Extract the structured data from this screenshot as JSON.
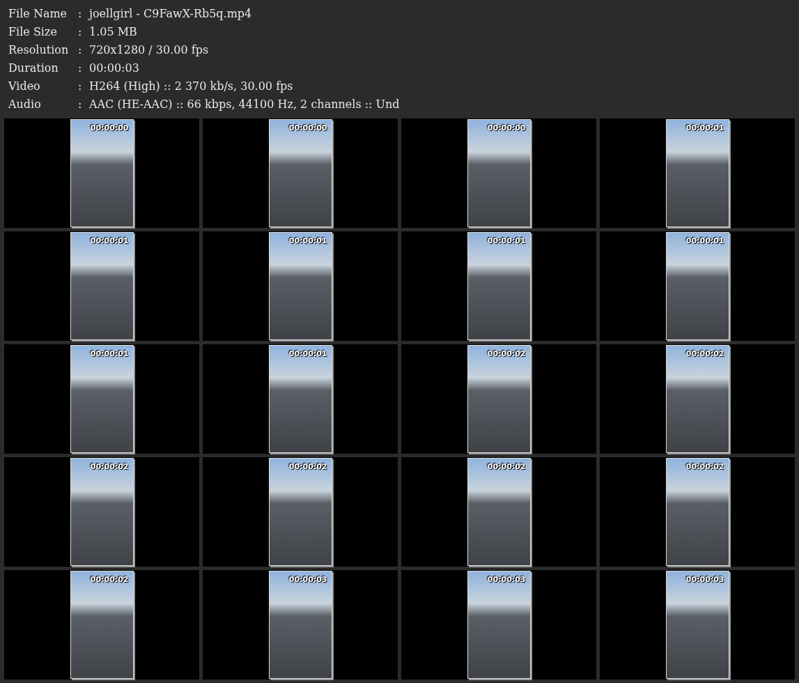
{
  "info": [
    {
      "label": "File Name",
      "value": "joellgirl - C9FawX-Rb5q.mp4"
    },
    {
      "label": "File Size",
      "value": "1.05 MB"
    },
    {
      "label": "Resolution",
      "value": "720x1280 / 30.00 fps"
    },
    {
      "label": "Duration",
      "value": "00:00:03"
    },
    {
      "label": "Video",
      "value": "H264 (High) :: 2 370 kb/s, 30.00 fps"
    },
    {
      "label": "Audio",
      "value": "AAC (HE-AAC) :: 66 kbps, 44100 Hz, 2 channels :: Und"
    }
  ],
  "separator": ":",
  "frames": [
    {
      "time": "00:00:00"
    },
    {
      "time": "00:00:00"
    },
    {
      "time": "00:00:00"
    },
    {
      "time": "00:00:01"
    },
    {
      "time": "00:00:01"
    },
    {
      "time": "00:00:01"
    },
    {
      "time": "00:00:01"
    },
    {
      "time": "00:00:01"
    },
    {
      "time": "00:00:01"
    },
    {
      "time": "00:00:01"
    },
    {
      "time": "00:00:02"
    },
    {
      "time": "00:00:02"
    },
    {
      "time": "00:00:02"
    },
    {
      "time": "00:00:02"
    },
    {
      "time": "00:00:02"
    },
    {
      "time": "00:00:02"
    },
    {
      "time": "00:00:02"
    },
    {
      "time": "00:00:03"
    },
    {
      "time": "00:00:03"
    },
    {
      "time": "00:00:03"
    }
  ]
}
